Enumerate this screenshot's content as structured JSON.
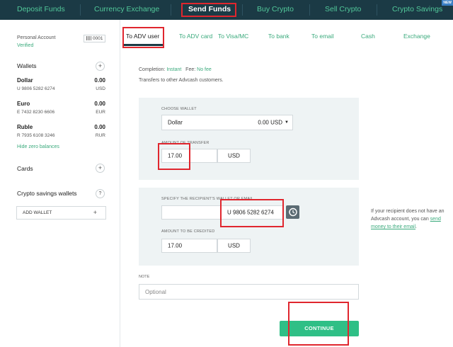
{
  "topnav": {
    "tabs": [
      {
        "label": "Deposit Funds"
      },
      {
        "label": "Currency Exchange"
      },
      {
        "label": "Send Funds"
      },
      {
        "label": "Buy Crypto"
      },
      {
        "label": "Sell Crypto"
      },
      {
        "label": "Crypto Savings"
      }
    ],
    "new_badge": "NEW",
    "active_tab": "Send Funds"
  },
  "sidebar": {
    "account_label": "Personal Account",
    "account_status": "Verified",
    "account_id": "0001",
    "wallets_title": "Wallets",
    "wallets": [
      {
        "name": "Dollar",
        "number": "U 9806 5282 6274",
        "amount": "0.00",
        "currency": "USD"
      },
      {
        "name": "Euro",
        "number": "E 7432 8230 6606",
        "amount": "0.00",
        "currency": "EUR"
      },
      {
        "name": "Ruble",
        "number": "R 7935 6108 3246",
        "amount": "0.00",
        "currency": "RUR"
      }
    ],
    "hide_zero": "Hide zero balances",
    "cards_title": "Cards",
    "crypto_title": "Crypto savings wallets",
    "crypto_help": "?",
    "add_wallet": "ADD WALLET",
    "plus": "+"
  },
  "subtabs": [
    {
      "label": "To ADV user"
    },
    {
      "label": "To ADV card"
    },
    {
      "label": "To Visa/MC"
    },
    {
      "label": "To bank"
    },
    {
      "label": "To email"
    },
    {
      "label": "Cash"
    },
    {
      "label": "Exchange"
    }
  ],
  "form": {
    "completion_label": "Completion:",
    "completion_value": "Instant",
    "fee_label": "Fee:",
    "fee_value": "No fee",
    "description": "Transfers to other Advcash customers.",
    "choose_wallet_label": "CHOOSE WALLET",
    "wallet_selected_name": "Dollar",
    "wallet_selected_balance": "0.00 USD",
    "amount_label": "AMOUNT OF TRANSFER",
    "amount_value": "17.00",
    "amount_currency": "USD",
    "recipient_label": "SPECIFY THE RECIPIENT'S WALLET OR EMAIL",
    "recipient_value": "U 9806 5282 6274",
    "credited_label": "AMOUNT TO BE CREDITED",
    "credited_value": "17.00",
    "credited_currency": "USD",
    "note_label": "NOTE",
    "note_placeholder": "Optional",
    "continue_label": "CONTINUE",
    "side_note_text": "If your recipient does not have an Advcash account, you can",
    "side_note_link": "send money to their email"
  },
  "colors": {
    "nav_bg": "#1b3a45",
    "accent": "#3aaa7c",
    "button": "#2fbf86",
    "highlight": "#e0262e"
  }
}
